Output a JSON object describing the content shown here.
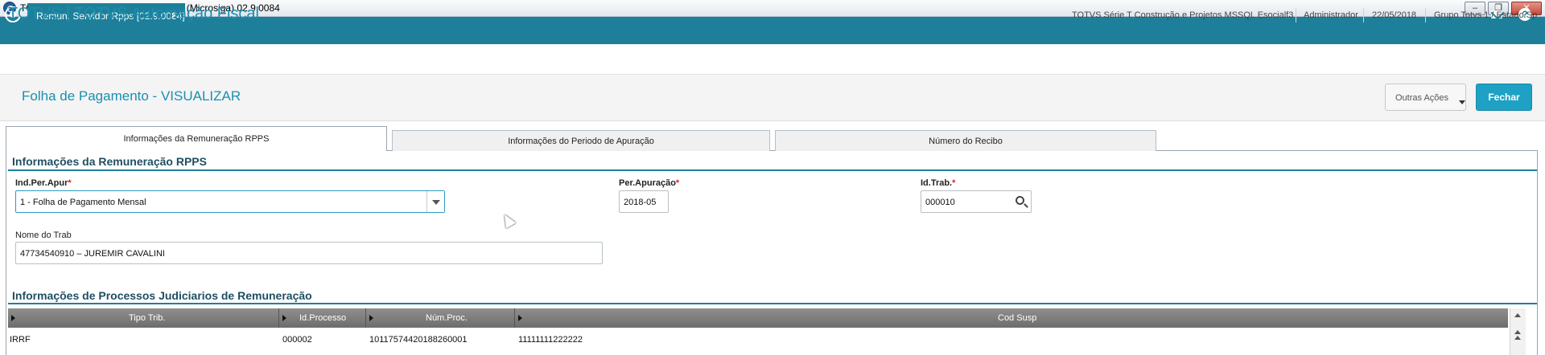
{
  "window": {
    "title": "TOTVS Série T Construção e Projetos (Microsiga) 02.9.0084",
    "min_symbol": "–",
    "max_symbol": "❐",
    "close_symbol": "✕"
  },
  "tabbar": {
    "active_tab": "Remun. Servidor Rpps [02.9.0084]",
    "close_symbol": "×",
    "help_symbol": "?"
  },
  "header": {
    "brand": "TOTVS | TOTVS Automação Fiscal",
    "environment": "TOTVS Série T Construção e Projetos MSSQL Esocialf3",
    "user": "Administrador",
    "date": "22/05/2018",
    "company": "Grupo Totvs 1 / Estado Sp"
  },
  "page": {
    "title": "Folha de Pagamento - VISUALIZAR",
    "other_actions_label": "Outras Ações",
    "close_label": "Fechar"
  },
  "folders": [
    {
      "label": "Informações da Remuneração RPPS"
    },
    {
      "label": "Informações do Periodo de Apuração"
    },
    {
      "label": "Número do Recibo"
    }
  ],
  "section1": {
    "title": "Informações da Remuneração RPPS",
    "ind_per_apur": {
      "label": "Ind.Per.Apur",
      "value": "1 - Folha de Pagamento Mensal"
    },
    "per_apuracao": {
      "label": "Per.Apuração",
      "value": "2018-05"
    },
    "id_trab": {
      "label": "Id.Trab.",
      "value": "000010"
    },
    "nome_trab": {
      "label": "Nome do Trab",
      "value": "47734540910 – JUREMIR CAVALINI"
    },
    "required_mark": "*"
  },
  "section2": {
    "title": "Informações de Processos Judiciarios de Remuneração",
    "columns": [
      "Tipo Trib.",
      "Id.Processo",
      "Núm.Proc.",
      "Cod Susp"
    ],
    "rows": [
      {
        "tipo_trib": "IRRF",
        "id_processo": "000002",
        "num_proc": "10117574420188260001",
        "cod_susp": "11111111222222"
      }
    ]
  },
  "icons": {
    "app": "totvs-logo-icon",
    "home": "home-icon",
    "mail": "mail-icon",
    "help": "help-icon",
    "search": "search-icon",
    "dropdown": "chevron-down-icon"
  },
  "colors": {
    "tabbar": "#1d7f99",
    "brand": "#1a8fb0",
    "primary_button": "#1ea1c4",
    "required": "#dd2222",
    "grid_header": "#7a7a7a"
  }
}
